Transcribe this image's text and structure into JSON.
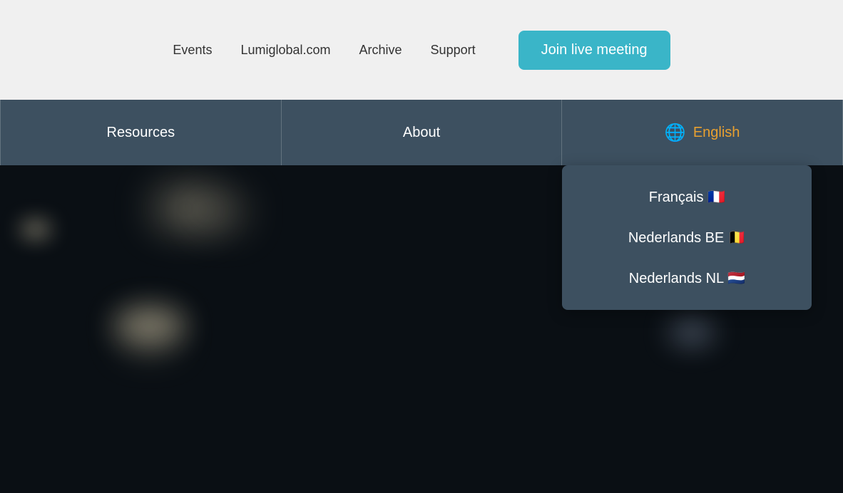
{
  "topNav": {
    "items": [
      {
        "label": "Events",
        "id": "events"
      },
      {
        "label": "Lumiglobal.com",
        "id": "lumiglobal"
      },
      {
        "label": "Archive",
        "id": "archive"
      },
      {
        "label": "Support",
        "id": "support"
      }
    ],
    "joinButton": "Join live meeting"
  },
  "secondaryNav": {
    "items": [
      {
        "label": "Resources",
        "id": "resources"
      },
      {
        "label": "About",
        "id": "about"
      }
    ],
    "languageSelector": {
      "label": "English",
      "icon": "🌐"
    }
  },
  "languageDropdown": {
    "items": [
      {
        "label": "Français",
        "flag": "🇫🇷",
        "id": "fr"
      },
      {
        "label": "Nederlands BE",
        "flag": "🇧🇪",
        "id": "nl-be"
      },
      {
        "label": "Nederlands NL",
        "flag": "🇳🇱",
        "id": "nl-nl"
      }
    ]
  },
  "colors": {
    "topNavBg": "#f0f0f0",
    "secondaryNavBg": "#3d5060",
    "joinButtonBg": "#3ab5c8",
    "languageColor": "#e8a030",
    "heroBg": "#0a0f14"
  }
}
